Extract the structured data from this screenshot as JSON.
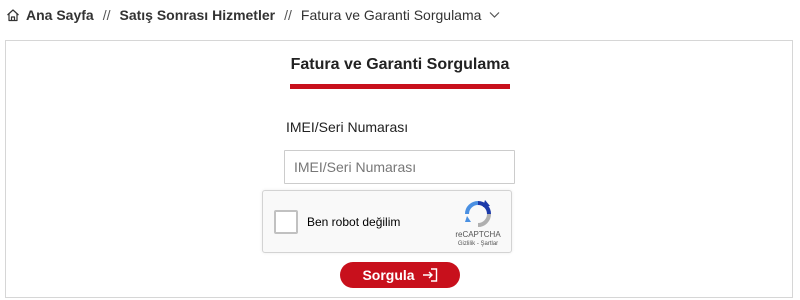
{
  "breadcrumb": {
    "home_label": "Ana Sayfa",
    "separator": "//",
    "section_label": "Satış Sonrası Hizmetler",
    "current_label": "Fatura ve Garanti Sorgulama",
    "home_icon": "home-icon",
    "dropdown_icon": "chevron-down-icon"
  },
  "form": {
    "title": "Fatura ve Garanti Sorgulama",
    "imei_label": "IMEI/Seri Numarası",
    "imei_placeholder": "IMEI/Seri Numarası",
    "imei_value": "",
    "submit_label": "Sorgula",
    "submit_icon": "login-arrow-icon"
  },
  "recaptcha": {
    "checkbox_label": "Ben robot değilim",
    "brand": "reCAPTCHA",
    "terms": "Gizlilik - Şartlar",
    "checked": false
  },
  "colors": {
    "accent": "#c8101c",
    "border": "#d6d6d6"
  }
}
